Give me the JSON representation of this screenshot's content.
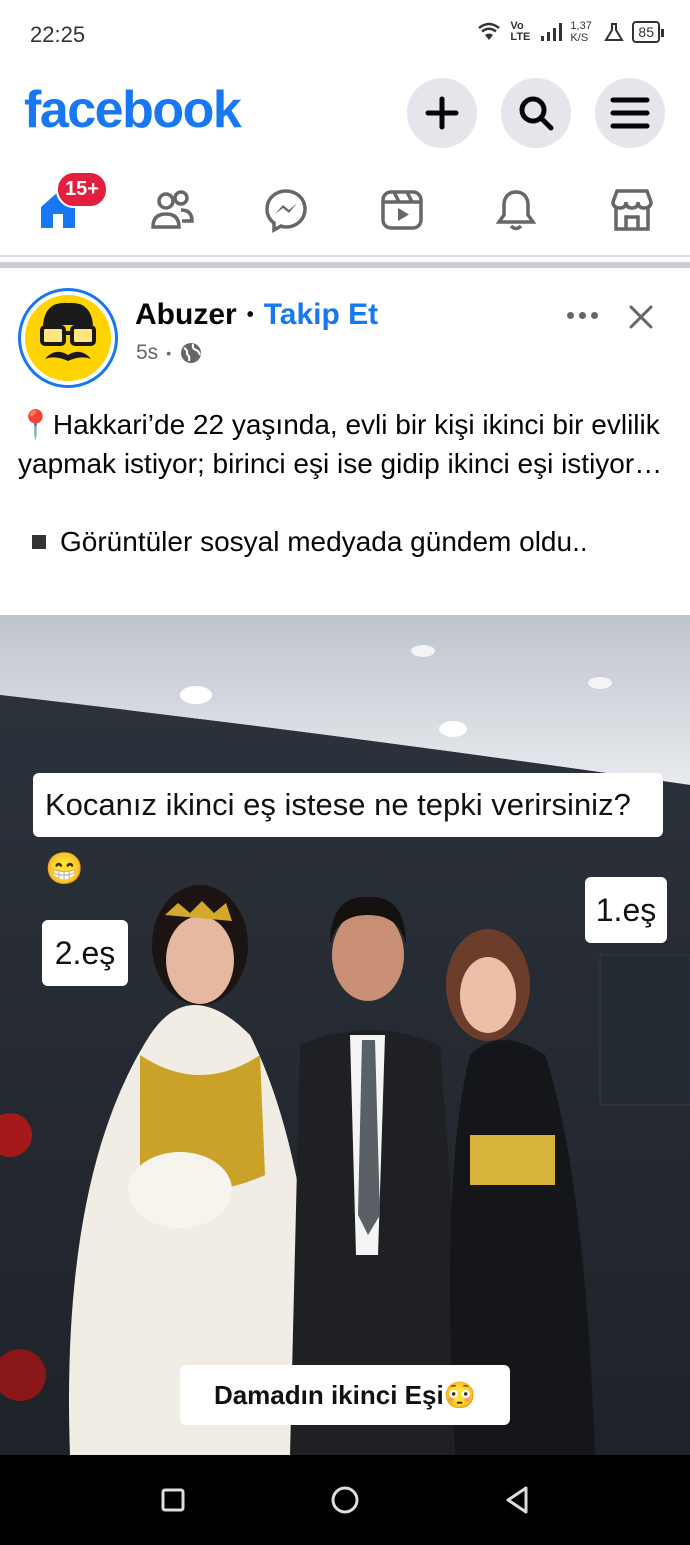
{
  "status_bar": {
    "time": "22:25",
    "network": "Vo LTE",
    "speed": "1,37 K/S",
    "battery": "85"
  },
  "header": {
    "logo": "facebook",
    "buttons": [
      "plus-icon",
      "search-icon",
      "menu-icon"
    ]
  },
  "nav": {
    "items": [
      "home-icon",
      "friends-icon",
      "messenger-icon",
      "video-icon",
      "notifications-icon",
      "marketplace-icon"
    ],
    "home_badge": "15+"
  },
  "post": {
    "author": "Abuzer",
    "separator": "•",
    "follow_label": "Takip Et",
    "time": "5s",
    "meta_separator": "•",
    "text_line1": "📍Hakkari’de 22 yaşında, evli bir kişi ikinci bir evlilik yapmak istiyor; birinci eşi ise gidip ikinci eşi istiyor…",
    "text_line2": "Görüntüler sosyal medyada gündem oldu.."
  },
  "media": {
    "caption_main": "Kocanız ikinci eş istese ne tepki verirsiniz? 😁",
    "caption_left": "2.eş",
    "caption_right": "1.eş",
    "caption_bottom": "Damadın ikinci Eşi😳"
  },
  "colors": {
    "brand": "#1877f2",
    "badge": "#e41e3f",
    "meta": "#65676b"
  }
}
